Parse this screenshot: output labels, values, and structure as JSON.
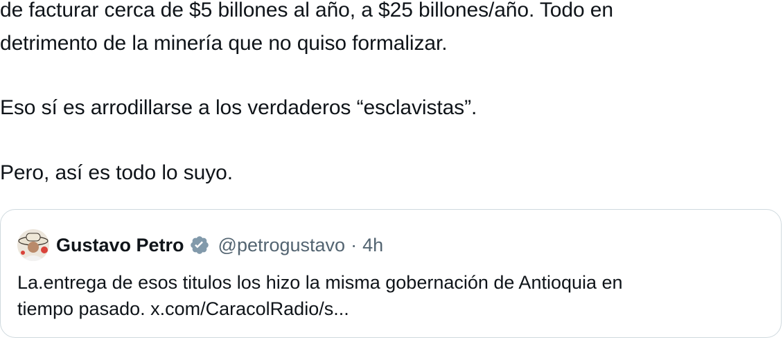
{
  "tweet": {
    "lines": [
      "de facturar cerca de $5 billones al año, a $25 billones/año. Todo en",
      "detrimento de la minería que no quiso formalizar.",
      "Eso sí es arrodillarse a los verdaderos “esclavistas”.",
      "Pero, así es todo lo suyo."
    ]
  },
  "quote": {
    "author_name": "Gustavo Petro",
    "verified_icon": "verified-badge-icon",
    "handle": "@petrogustavo",
    "separator": "·",
    "time": "4h",
    "text_lines": [
      "La.entrega de esos titulos los hizo la misma gobernación de Antioquia en",
      "tiempo pasado. x.com/CaracolRadio/s..."
    ]
  },
  "colors": {
    "text": "#0f1419",
    "secondary": "#536471",
    "border": "#cfd9de",
    "verified": "#829aab"
  }
}
